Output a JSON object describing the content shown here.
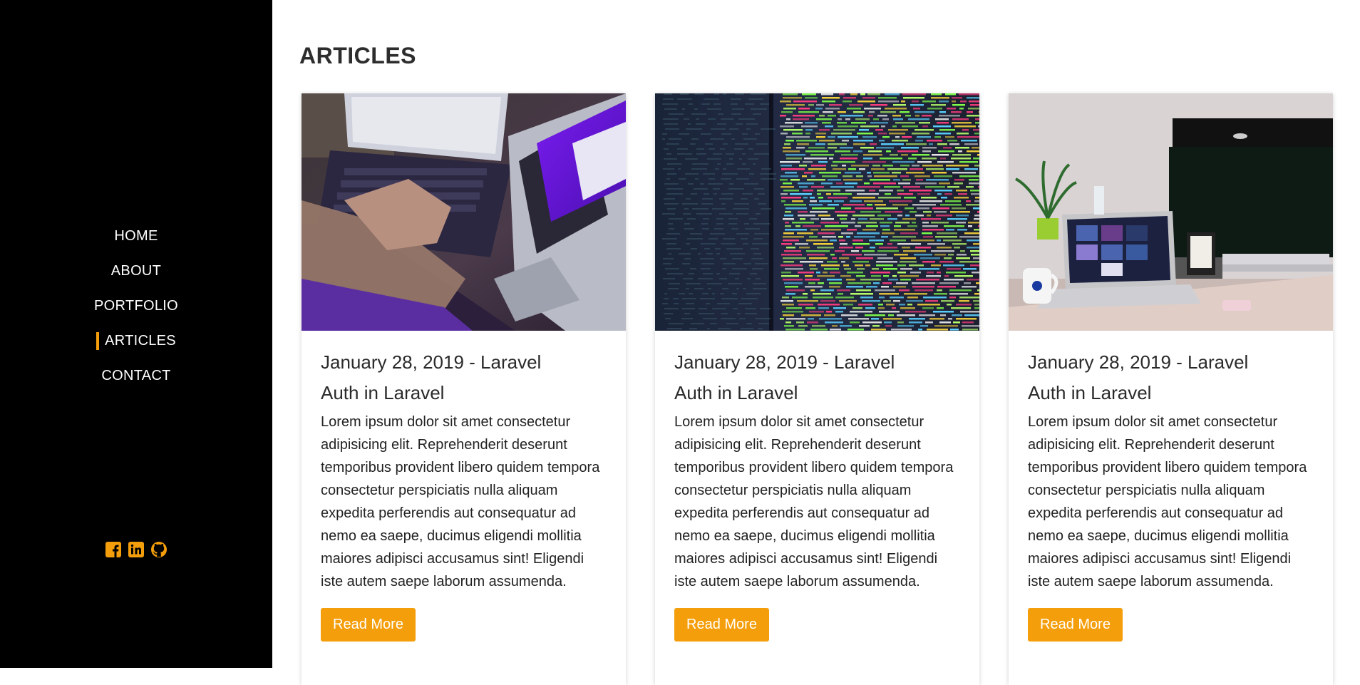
{
  "sidebar": {
    "nav": [
      {
        "label": "HOME",
        "active": false
      },
      {
        "label": "ABOUT",
        "active": false
      },
      {
        "label": "PORTFOLIO",
        "active": false
      },
      {
        "label": "ARTICLES",
        "active": true
      },
      {
        "label": "CONTACT",
        "active": false
      }
    ],
    "social": [
      "facebook-icon",
      "linkedin-icon",
      "github-icon"
    ],
    "accent_color": "#f59e0b"
  },
  "main": {
    "heading": "ARTICLES",
    "articles": [
      {
        "meta": "January 28, 2019 - Laravel",
        "title": "Auth in Laravel",
        "excerpt": "Lorem ipsum dolor sit amet consectetur adipisicing elit. Reprehenderit deserunt temporibus provident libero quidem tempora consectetur perspiciatis nulla aliquam expedita perferendis aut consequatur ad nemo ea saepe, ducimus eligendi mollitia maiores adipisci accusamus sint! Eligendi iste autem saepe laborum assumenda.",
        "button": "Read More"
      },
      {
        "meta": "January 28, 2019 - Laravel",
        "title": "Auth in Laravel",
        "excerpt": "Lorem ipsum dolor sit amet consectetur adipisicing elit. Reprehenderit deserunt temporibus provident libero quidem tempora consectetur perspiciatis nulla aliquam expedita perferendis aut consequatur ad nemo ea saepe, ducimus eligendi mollitia maiores adipisci accusamus sint! Eligendi iste autem saepe laborum assumenda.",
        "button": "Read More"
      },
      {
        "meta": "January 28, 2019 - Laravel",
        "title": "Auth in Laravel",
        "excerpt": "Lorem ipsum dolor sit amet consectetur adipisicing elit. Reprehenderit deserunt temporibus provident libero quidem tempora consectetur perspiciatis nulla aliquam expedita perferendis aut consequatur ad nemo ea saepe, ducimus eligendi mollitia maiores adipisci accusamus sint! Eligendi iste autem saepe laborum assumenda.",
        "button": "Read More"
      }
    ]
  }
}
